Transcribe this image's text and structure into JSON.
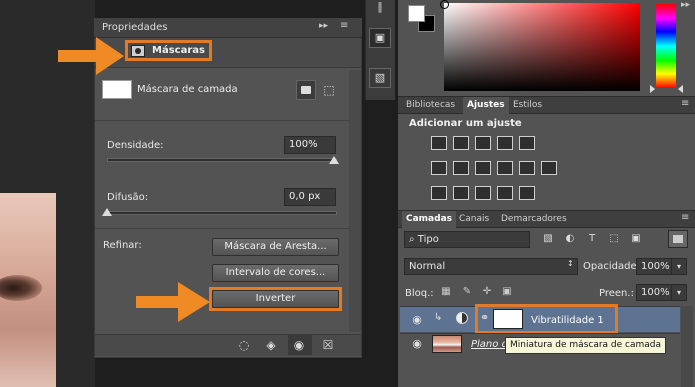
{
  "properties": {
    "title": "Propriedades",
    "collapse": "▸▸",
    "menu": "≡",
    "masks_label": "Máscaras",
    "layer_mask_label": "Máscara de camada",
    "density": {
      "label": "Densidade:",
      "value": "100%",
      "slider_fraction": 1.0
    },
    "feather": {
      "label": "Difusão:",
      "value": "0,0 px",
      "slider_fraction": 0.0
    },
    "refine_label": "Refinar:",
    "buttons": {
      "mask_edge": "Máscara de Aresta...",
      "color_range": "Intervalo de cores...",
      "invert": "Inverter"
    },
    "footer_icons": {
      "load_selection": "◌",
      "apply_mask": "◈",
      "visibility": "◉",
      "delete": "☒"
    },
    "vector_mask_icon": "⬚"
  },
  "tools": {
    "tool1": "‖",
    "tool2": "▣",
    "tool3": "▧"
  },
  "color": {
    "foreground": "#ffffff",
    "background": "#000000",
    "hue": "#ff0000",
    "collapse": "▸▸"
  },
  "adjustments": {
    "tabs": [
      "Bibliotecas",
      "Ajustes",
      "Estilos"
    ],
    "active_tab": "Ajustes",
    "menu": "≡",
    "heading": "Adicionar um ajuste",
    "icons_row1": [
      "brightness-contrast-icon",
      "levels-icon",
      "curves-icon",
      "exposure-icon",
      "gradient-triangle-icon"
    ],
    "icons_row2": [
      "hue-saturation-icon",
      "color-balance-icon",
      "black-white-icon",
      "photo-filter-icon",
      "channel-mixer-icon",
      "color-lookup-icon"
    ],
    "icons_row3": [
      "invert-icon",
      "posterize-icon",
      "threshold-icon",
      "selective-color-icon",
      "gradient-map-icon"
    ]
  },
  "layers": {
    "tabs": [
      "Camadas",
      "Canais",
      "Demarcadores"
    ],
    "active_tab": "Camadas",
    "menu": "≡",
    "kind_filter": "⌕ Tipo",
    "filter_icons": [
      "▧",
      "◐",
      "T",
      "⬚",
      "▣"
    ],
    "blend_mode": "Normal",
    "blend_caret": "↕",
    "opacity_label": "Opacidade:",
    "opacity_value": "100%",
    "lock_label": "Bloq.:",
    "lock_icons": [
      "▦",
      "✎",
      "✛",
      "▣"
    ],
    "fill_label": "Preen.:",
    "fill_value": "100%",
    "dropdown_arrow": "▾",
    "rows": [
      {
        "name": "Vibratilidade 1",
        "eye": "◉",
        "clip": "↳",
        "chain": "⚭"
      },
      {
        "name": "Plano d",
        "eye": "◉"
      }
    ],
    "tooltip": "Miniatura de máscara de camada"
  }
}
